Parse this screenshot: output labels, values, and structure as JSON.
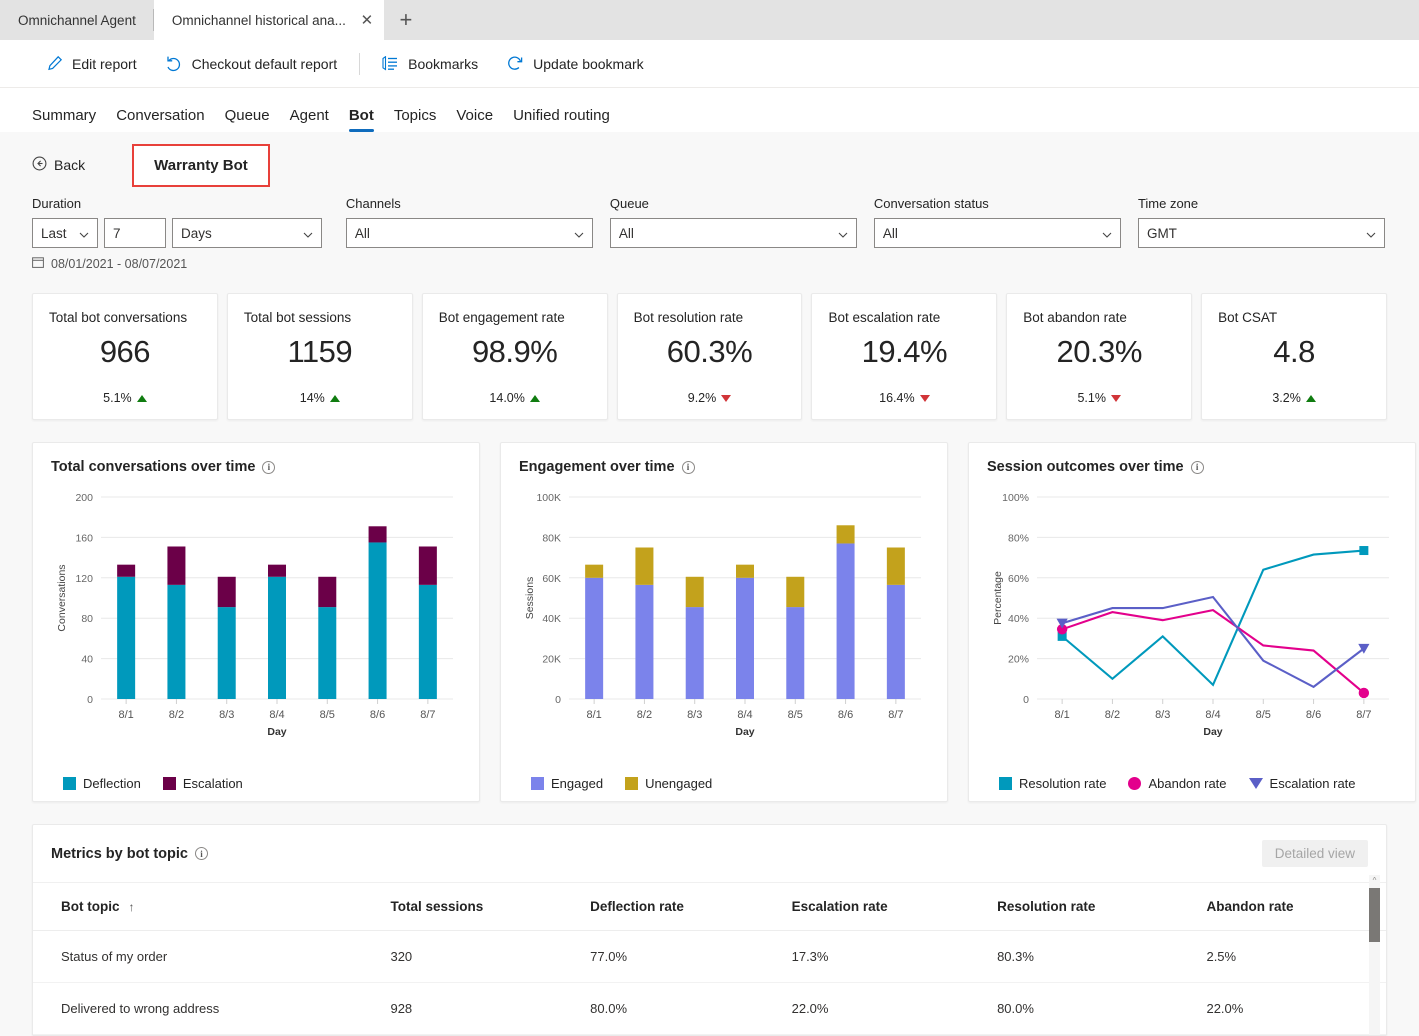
{
  "browser": {
    "tabs": [
      {
        "title": "Omnichannel Agent",
        "active": false
      },
      {
        "title": "Omnichannel historical ana...",
        "active": true
      }
    ],
    "close_label": "✕",
    "new_tab_label": "+"
  },
  "toolbar": {
    "edit_report": "Edit report",
    "checkout_default_report": "Checkout default report",
    "bookmarks": "Bookmarks",
    "update_bookmark": "Update bookmark",
    "icon_color": "#0078d4"
  },
  "nav": {
    "tabs": [
      {
        "label": "Summary",
        "selected": false
      },
      {
        "label": "Conversation",
        "selected": false
      },
      {
        "label": "Queue",
        "selected": false
      },
      {
        "label": "Agent",
        "selected": false
      },
      {
        "label": "Bot",
        "selected": true
      },
      {
        "label": "Topics",
        "selected": false
      },
      {
        "label": "Voice",
        "selected": false
      },
      {
        "label": "Unified routing",
        "selected": false
      }
    ],
    "accent": "#0f6cbd"
  },
  "header": {
    "back_label": "Back",
    "bot_name": "Warranty Bot",
    "highlight_color": "#e8403a"
  },
  "filters": {
    "duration": {
      "label": "Duration",
      "relative_value": "Last",
      "number_value": "7",
      "unit_value": "Days"
    },
    "channels": {
      "label": "Channels",
      "value": "All"
    },
    "queue": {
      "label": "Queue",
      "value": "All"
    },
    "conversation_status": {
      "label": "Conversation status",
      "value": "All"
    },
    "time_zone": {
      "label": "Time zone",
      "value": "GMT"
    },
    "date_range": "08/01/2021 - 08/07/2021"
  },
  "kpis": [
    {
      "title": "Total bot conversations",
      "value": "966",
      "delta": "5.1%",
      "direction": "up"
    },
    {
      "title": "Total bot sessions",
      "value": "1159",
      "delta": "14%",
      "direction": "up"
    },
    {
      "title": "Bot engagement rate",
      "value": "98.9%",
      "delta": "14.0%",
      "direction": "up"
    },
    {
      "title": "Bot resolution rate",
      "value": "60.3%",
      "delta": "9.2%",
      "direction": "down"
    },
    {
      "title": "Bot escalation rate",
      "value": "19.4%",
      "delta": "16.4%",
      "direction": "down"
    },
    {
      "title": "Bot abandon rate",
      "value": "20.3%",
      "delta": "5.1%",
      "direction": "down"
    },
    {
      "title": "Bot CSAT",
      "value": "4.8",
      "delta": "3.2%",
      "direction": "up"
    }
  ],
  "chart_data": [
    {
      "type": "bar",
      "stacked": true,
      "title": "Total conversations over time",
      "xlabel": "Day",
      "ylabel": "Conversations",
      "categories": [
        "8/1",
        "8/2",
        "8/3",
        "8/4",
        "8/5",
        "8/6",
        "8/7"
      ],
      "ylim": [
        0,
        200
      ],
      "yticks": [
        0,
        40,
        80,
        120,
        160,
        200
      ],
      "ytick_labels": [
        "0",
        "40",
        "80",
        "120",
        "160",
        "200"
      ],
      "grid": true,
      "legend_position": "bottom",
      "series": [
        {
          "name": "Deflection",
          "color": "#0099bc",
          "values": [
            121,
            113,
            91,
            121,
            91,
            155,
            113
          ]
        },
        {
          "name": "Escalation",
          "color": "#6b0048",
          "values": [
            12,
            38,
            30,
            12,
            30,
            16,
            38
          ]
        }
      ],
      "totals": [
        133,
        151,
        121,
        133,
        121,
        171,
        151
      ]
    },
    {
      "type": "bar",
      "stacked": true,
      "title": "Engagement over time",
      "xlabel": "Day",
      "ylabel": "Sessions",
      "categories": [
        "8/1",
        "8/2",
        "8/3",
        "8/4",
        "8/5",
        "8/6",
        "8/7"
      ],
      "ylim": [
        0,
        100000
      ],
      "yticks": [
        0,
        20000,
        40000,
        60000,
        80000,
        100000
      ],
      "ytick_labels": [
        "0",
        "20K",
        "40K",
        "60K",
        "80K",
        "100K"
      ],
      "grid": true,
      "legend_position": "bottom",
      "series": [
        {
          "name": "Engaged",
          "color": "#7b83eb",
          "values": [
            60000,
            56500,
            45500,
            60000,
            45500,
            77000,
            56500
          ]
        },
        {
          "name": "Unengaged",
          "color": "#c3a21c",
          "values": [
            6500,
            18500,
            15000,
            6500,
            15000,
            9000,
            18500
          ]
        }
      ],
      "totals": [
        66500,
        75000,
        60500,
        66500,
        60500,
        86000,
        75000
      ]
    },
    {
      "type": "line",
      "title": "Session outcomes over time",
      "xlabel": "Day",
      "ylabel": "Percentage",
      "x": [
        "8/1",
        "8/2",
        "8/3",
        "8/4",
        "8/5",
        "8/6",
        "8/7"
      ],
      "ylim": [
        0,
        100
      ],
      "yticks": [
        0,
        20,
        40,
        60,
        80,
        100
      ],
      "ytick_labels": [
        "0",
        "20%",
        "40%",
        "60%",
        "80%",
        "100%"
      ],
      "grid": true,
      "legend_position": "bottom",
      "series": [
        {
          "name": "Resolution rate",
          "color": "#0099bc",
          "marker": "square",
          "values": [
            31,
            10,
            31,
            7,
            64,
            71.5,
            73.5
          ]
        },
        {
          "name": "Abandon rate",
          "color": "#e3008c",
          "marker": "circle",
          "values": [
            34.5,
            43,
            39,
            44,
            26.5,
            24,
            3
          ]
        },
        {
          "name": "Escalation rate",
          "color": "#5b5fc7",
          "marker": "triangle",
          "values": [
            37.5,
            45,
            45,
            50.5,
            19,
            6,
            25
          ]
        }
      ]
    }
  ],
  "topic_table": {
    "title": "Metrics by bot topic",
    "detailed_view_label": "Detailed view",
    "sort_indicator": "↑",
    "columns": [
      "Bot topic",
      "Total sessions",
      "Deflection rate",
      "Escalation rate",
      "Resolution rate",
      "Abandon rate"
    ],
    "rows": [
      [
        "Status of my order",
        "320",
        "77.0%",
        "17.3%",
        "80.3%",
        "2.5%"
      ],
      [
        "Delivered to wrong address",
        "928",
        "80.0%",
        "22.0%",
        "80.0%",
        "22.0%"
      ]
    ]
  }
}
